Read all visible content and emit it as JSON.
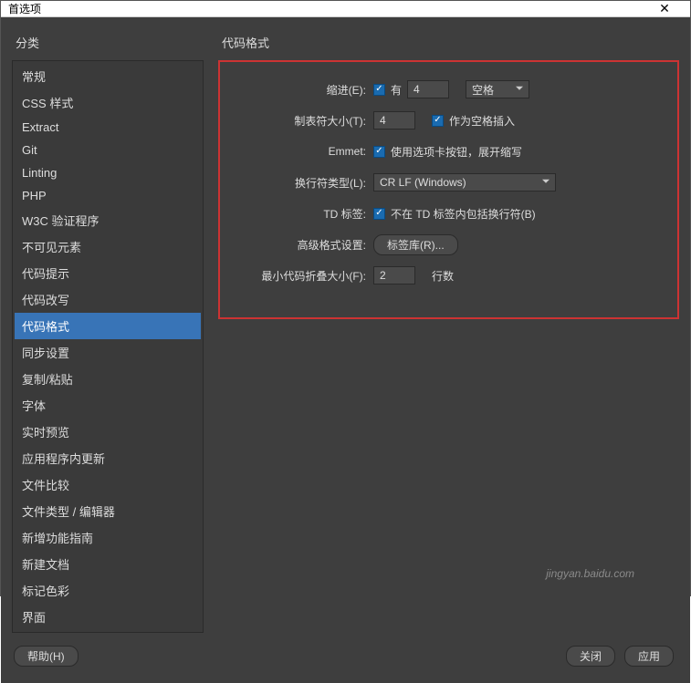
{
  "window": {
    "title": "首选项"
  },
  "left": {
    "header": "分类",
    "items": [
      "常规",
      "CSS 样式",
      "Extract",
      "Git",
      "Linting",
      "PHP",
      "W3C 验证程序",
      "不可见元素",
      "代码提示",
      "代码改写",
      "代码格式",
      "同步设置",
      "复制/粘贴",
      "字体",
      "实时预览",
      "应用程序内更新",
      "文件比较",
      "文件类型 / 编辑器",
      "新增功能指南",
      "新建文档",
      "标记色彩",
      "界面"
    ],
    "selectedIndex": 10
  },
  "right": {
    "header": "代码格式",
    "rows": {
      "indent": {
        "label": "缩进(E):",
        "check_text": "有",
        "value": "4",
        "unit": "空格"
      },
      "tabsize": {
        "label": "制表符大小(T):",
        "value": "4",
        "check_text": "作为空格插入"
      },
      "emmet": {
        "label": "Emmet:",
        "check_text": "使用选项卡按钮，展开缩写"
      },
      "linebreak": {
        "label": "换行符类型(L):",
        "value": "CR LF (Windows)"
      },
      "tdtag": {
        "label": "TD 标签:",
        "check_text": "不在 TD 标签内包括换行符(B)"
      },
      "advfmt": {
        "label": "高级格式设置:",
        "button": "标签库(R)..."
      },
      "minfold": {
        "label": "最小代码折叠大小(F):",
        "value": "2",
        "suffix": "行数"
      }
    }
  },
  "footer": {
    "help": "帮助(H)",
    "close": "关闭",
    "apply": "应用"
  },
  "watermark": "jingyan.baidu.com"
}
